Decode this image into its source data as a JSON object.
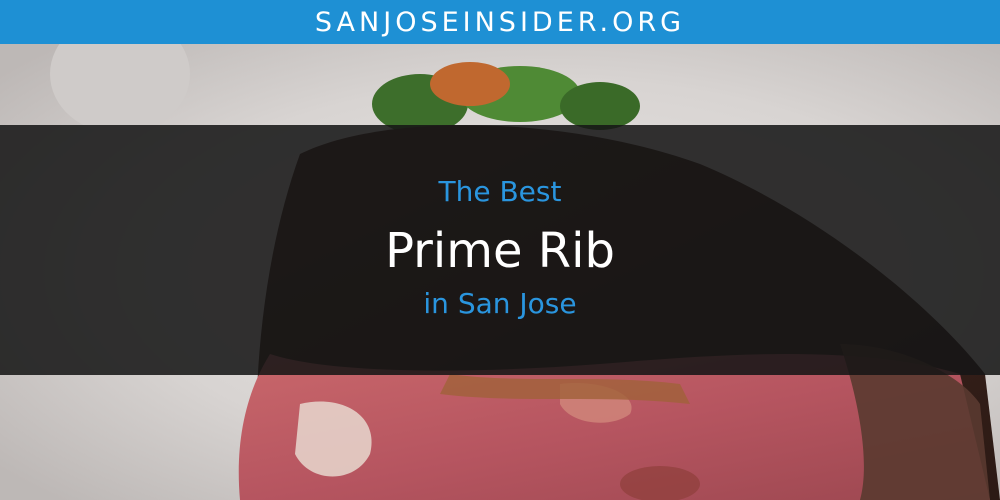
{
  "banner": {
    "site_name": "SANJOSEINSIDER.ORG",
    "background_color": "#1e90d4"
  },
  "hero": {
    "line_top": "The Best",
    "line_main": "Prime Rib",
    "line_bottom": "in San Jose",
    "accent_color": "#2a95de"
  },
  "background_photo": {
    "subject": "prime-rib-plate"
  }
}
